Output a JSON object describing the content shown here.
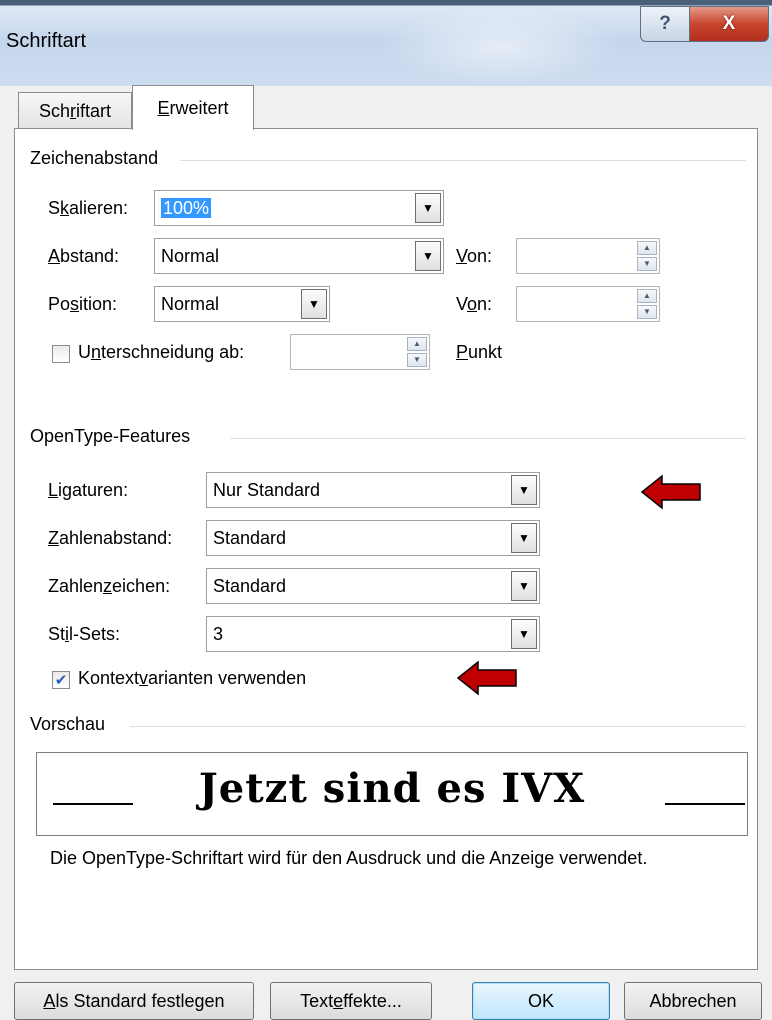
{
  "window": {
    "title": "Schriftart",
    "help_label": "?",
    "close_label": "X"
  },
  "tabs": [
    {
      "label_pre": "Sch",
      "label_acc": "r",
      "label_post": "iftart",
      "active": false
    },
    {
      "label_pre": "",
      "label_acc": "E",
      "label_post": "rweitert",
      "active": true
    }
  ],
  "zeichenabstand": {
    "title": "Zeichenabstand",
    "skalieren": {
      "label_pre": "S",
      "label_acc": "k",
      "label_post": "alieren:",
      "value": "100%"
    },
    "abstand": {
      "label_pre": "",
      "label_acc": "A",
      "label_post": "bstand:",
      "value": "Normal",
      "von_pre": "",
      "von_acc": "V",
      "von_post": "on:",
      "von_value": ""
    },
    "position": {
      "label_pre": "Po",
      "label_acc": "s",
      "label_post": "ition:",
      "value": "Normal",
      "von_pre": "V",
      "von_acc": "o",
      "von_post": "n:",
      "von_value": ""
    },
    "unterschneidung": {
      "label_pre": "U",
      "label_acc": "n",
      "label_post": "terschneidung ab:",
      "checked": false,
      "value": "",
      "unit_pre": "",
      "unit_acc": "P",
      "unit_post": "unkt"
    }
  },
  "opentype": {
    "title": "OpenType-Features",
    "ligaturen": {
      "label_pre": "",
      "label_acc": "L",
      "label_post": "igaturen:",
      "value": "Nur Standard"
    },
    "zahlenabstand": {
      "label_pre": "",
      "label_acc": "Z",
      "label_post": "ahlenabstand:",
      "value": "Standard"
    },
    "zahlenzeichen": {
      "label_pre": "Zahlen",
      "label_acc": "z",
      "label_post": "eichen:",
      "value": "Standard"
    },
    "stilsets": {
      "label_pre": "St",
      "label_acc": "i",
      "label_post": "l-Sets:",
      "value": "3"
    },
    "kontext": {
      "label_pre": "Kontext",
      "label_acc": "v",
      "label_post": "arianten verwenden",
      "checked": true
    }
  },
  "vorschau": {
    "title": "Vorschau",
    "sample": "Jetzt sind es IVX",
    "description": "Die OpenType-Schriftart wird für den Ausdruck und die Anzeige verwendet."
  },
  "buttons": {
    "default": {
      "pre": "",
      "acc": "A",
      "post": "ls Standard festlegen"
    },
    "effects": {
      "pre": "Text",
      "acc": "e",
      "post": "ffekte..."
    },
    "ok": "OK",
    "cancel": "Abbrechen"
  },
  "colors": {
    "annotation_arrow": "#c00000",
    "selection": "#3399ff"
  }
}
